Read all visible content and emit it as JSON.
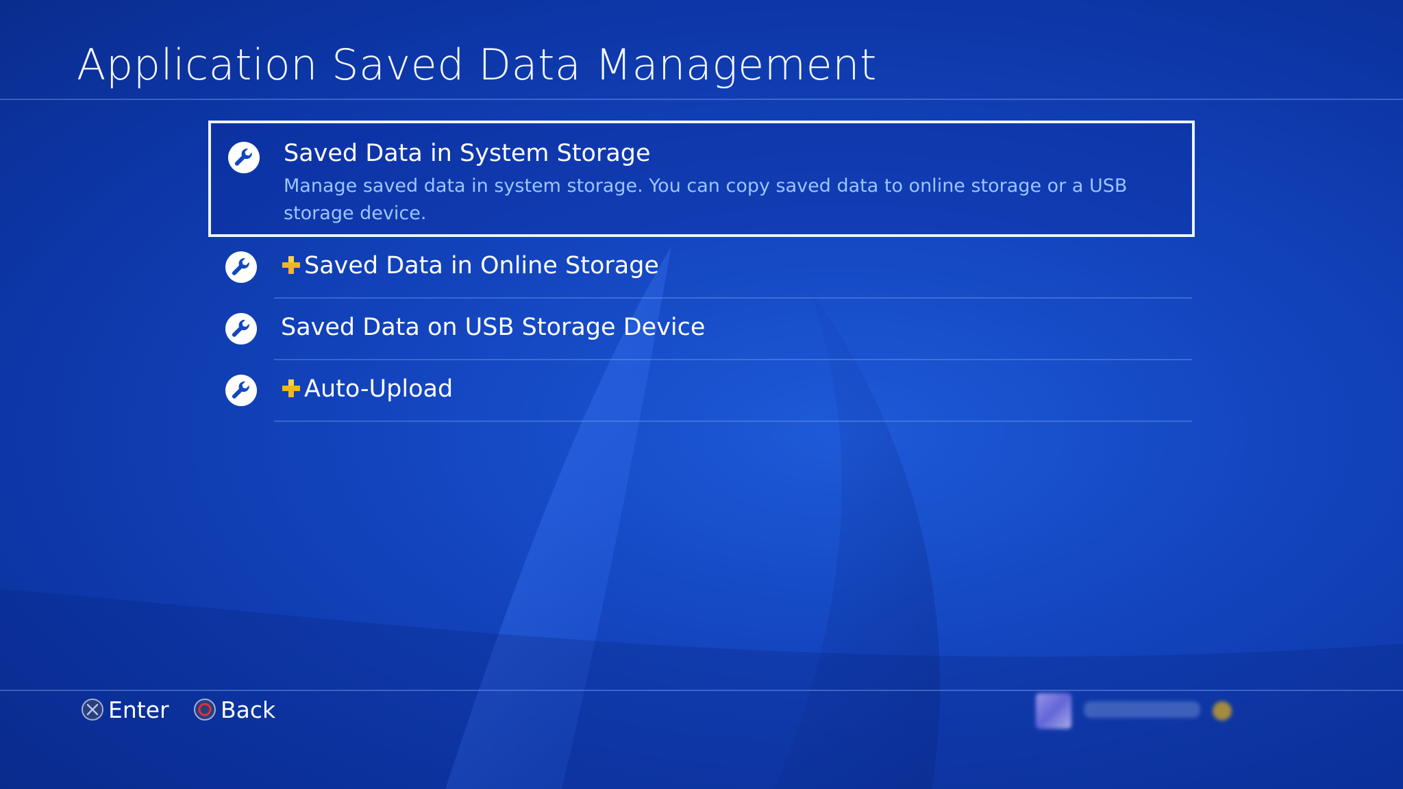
{
  "header": {
    "title": "Application Saved Data Management"
  },
  "menu": {
    "items": [
      {
        "label": "Saved Data in System Storage",
        "description": "Manage saved data in system storage. You can copy saved data to online storage or a USB storage device.",
        "icon": "wrench-icon",
        "plus": false,
        "selected": true
      },
      {
        "label": "Saved Data in Online Storage",
        "icon": "wrench-icon",
        "plus": true,
        "selected": false
      },
      {
        "label": "Saved Data on USB Storage Device",
        "icon": "wrench-icon",
        "plus": false,
        "selected": false
      },
      {
        "label": "Auto-Upload",
        "icon": "wrench-icon",
        "plus": true,
        "selected": false
      }
    ]
  },
  "footer": {
    "enter_label": "Enter",
    "enter_icon": "cross-button-icon",
    "back_label": "Back",
    "back_icon": "circle-button-icon"
  },
  "colors": {
    "background": "#1446c0",
    "description_text": "#9cc6ff",
    "selection_border": "#eef4ff",
    "plus_gold": "#f2b620",
    "circle_button_red": "#e0303a"
  }
}
